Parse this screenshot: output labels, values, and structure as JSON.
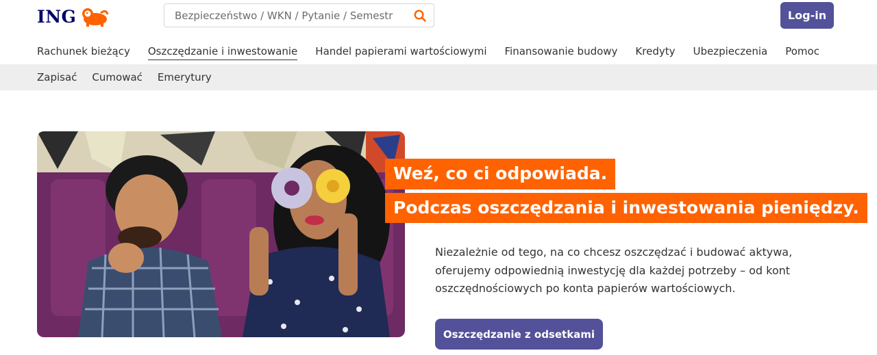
{
  "header": {
    "logo_text": "ING",
    "search_placeholder": "Bezpieczeństwo / WKN / Pytanie / Semestr",
    "login_label": "Log-in"
  },
  "main_nav": {
    "items": [
      {
        "label": "Rachunek bieżący",
        "active": false
      },
      {
        "label": "Oszczędzanie i inwestowanie",
        "active": true
      },
      {
        "label": "Handel papierami wartościowymi",
        "active": false
      },
      {
        "label": "Finansowanie budowy",
        "active": false
      },
      {
        "label": "Kredyty",
        "active": false
      },
      {
        "label": "Ubezpieczenia",
        "active": false
      },
      {
        "label": "Pomoc",
        "active": false
      }
    ]
  },
  "sub_nav": {
    "items": [
      {
        "label": "Zapisać"
      },
      {
        "label": "Cumować"
      },
      {
        "label": "Emerytury"
      }
    ]
  },
  "hero": {
    "headline_1": "Weź, co ci odpowiada.",
    "headline_2": "Podczas oszczędzania i inwestowania pieniędzy.",
    "body": "Niezależnie od tego, na co chcesz oszczędzać i budować aktywa, oferujemy odpowiednią inwestycję dla każdej potrzeby – od kont oszczędnościowych po konta papierów wartościowych.",
    "cta_label": "Oszczędzanie z odsetkami"
  },
  "colors": {
    "brand_orange": "#ff6200",
    "brand_navy": "#000066",
    "button_purple": "#525199",
    "subnav_bg": "#eeeeee"
  },
  "icons": {
    "logo": "lion-icon",
    "search": "search-icon"
  }
}
